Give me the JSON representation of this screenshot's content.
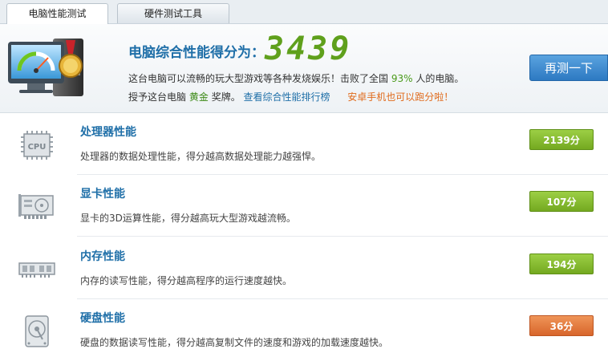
{
  "tabs": [
    {
      "label": "电脑性能测试"
    },
    {
      "label": "硬件测试工具"
    }
  ],
  "header": {
    "score_title": "电脑综合性能得分为：",
    "score_value": "3439",
    "line1_prefix": "这台电脑可以流畅的玩大型游戏等各种发烧娱乐！击败了全国",
    "line1_percent": "93%",
    "line1_suffix": "人的电脑。",
    "line2_prefix": "授予这台电脑",
    "line2_award": "黄金",
    "line2_mid": "奖牌。",
    "ranking_link": "查看综合性能排行榜",
    "android_link": "安卓手机也可以跑分啦！",
    "retest_label": "再测一下"
  },
  "items": [
    {
      "title": "处理器性能",
      "desc": "处理器的数据处理性能，得分越高数据处理能力越强悍。",
      "score": "2139分",
      "status": "good",
      "icon": "cpu-icon",
      "icon_text": "CPU"
    },
    {
      "title": "显卡性能",
      "desc": "显卡的3D运算性能，得分越高玩大型游戏越流畅。",
      "score": "107分",
      "status": "good",
      "icon": "graphics-card-icon"
    },
    {
      "title": "内存性能",
      "desc": "内存的读写性能，得分越高程序的运行速度越快。",
      "score": "194分",
      "status": "good",
      "icon": "memory-icon"
    },
    {
      "title": "硬盘性能",
      "desc": "硬盘的数据读写性能，得分越高复制文件的速度和游戏的加载速度越快。",
      "score": "36分",
      "status": "poor",
      "icon": "hard-disk-icon"
    }
  ],
  "colors": {
    "accent_blue": "#1f6fa8",
    "score_green": "#5fa01c",
    "badge_good": "#84b92c",
    "badge_poor": "#e07034"
  }
}
